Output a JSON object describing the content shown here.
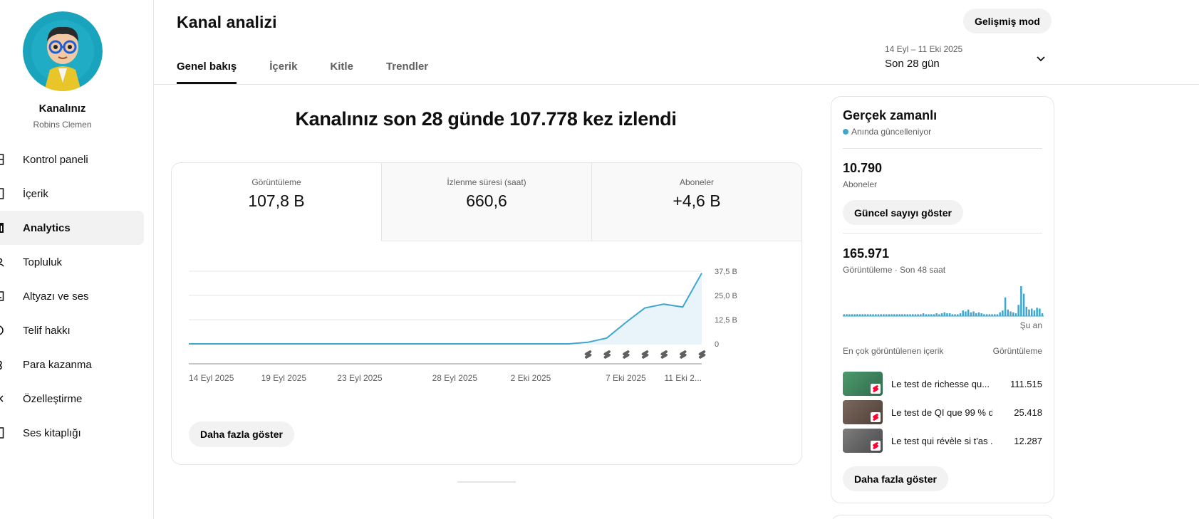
{
  "sidebar": {
    "channel_title": "Kanalınız",
    "channel_handle": "Robins Clemen",
    "items": [
      {
        "label": "Kontrol paneli",
        "icon": "dashboard-icon"
      },
      {
        "label": "İçerik",
        "icon": "content-icon"
      },
      {
        "label": "Analytics",
        "icon": "analytics-icon"
      },
      {
        "label": "Topluluk",
        "icon": "community-icon"
      },
      {
        "label": "Altyazı ve ses",
        "icon": "subtitles-icon"
      },
      {
        "label": "Telif hakkı",
        "icon": "copyright-icon"
      },
      {
        "label": "Para kazanma",
        "icon": "monetization-icon"
      },
      {
        "label": "Özelleştirme",
        "icon": "customization-icon"
      },
      {
        "label": "Ses kitaplığı",
        "icon": "audio-library-icon"
      }
    ]
  },
  "header": {
    "title": "Kanal analizi",
    "advanced_mode": "Gelişmiş mod",
    "tabs": [
      "Genel bakış",
      "İçerik",
      "Kitle",
      "Trendler"
    ],
    "date_range": "14 Eyl – 11 Eki 2025",
    "period": "Son 28 gün"
  },
  "main": {
    "headline": "Kanalınız son 28 günde 107.778 kez izlendi",
    "metrics": [
      {
        "label": "Görüntüleme",
        "value": "107,8 B"
      },
      {
        "label": "İzlenme süresi (saat)",
        "value": "660,6"
      },
      {
        "label": "Aboneler",
        "value": "+4,6 B"
      }
    ],
    "more_button": "Daha fazla göster"
  },
  "chart_data": {
    "type": "line",
    "x": [
      "14 Eyl",
      "15 Eyl",
      "16 Eyl",
      "17 Eyl",
      "18 Eyl",
      "19 Eyl",
      "20 Eyl",
      "21 Eyl",
      "22 Eyl",
      "23 Eyl",
      "24 Eyl",
      "25 Eyl",
      "26 Eyl",
      "27 Eyl",
      "28 Eyl",
      "29 Eyl",
      "30 Eyl",
      "1 Eki",
      "2 Eki",
      "3 Eki",
      "4 Eki",
      "5 Eki",
      "6 Eki",
      "7 Eki",
      "8 Eki",
      "9 Eki",
      "10 Eki",
      "11 Eki"
    ],
    "series": [
      {
        "values": [
          0,
          0,
          0,
          0,
          0,
          0,
          0,
          0,
          0,
          0,
          0,
          0,
          0,
          0,
          0,
          0,
          0,
          0,
          0,
          0,
          0,
          0.8,
          3,
          11,
          18.5,
          20.5,
          19,
          36.5
        ]
      }
    ],
    "xtick_labels": [
      "14 Eyl 2025",
      "19 Eyl 2025",
      "23 Eyl 2025",
      "28 Eyl 2025",
      "2 Eki 2025",
      "7 Eki 2025",
      "11 Eki 2..."
    ],
    "ytick_labels": [
      "0",
      "12,5 B",
      "25,0 B",
      "37,5 B"
    ],
    "ylim": [
      0,
      37.5
    ],
    "grid": true,
    "short_markers": 7,
    "colors": {
      "line": "#3ea6cf",
      "fill": "#e8f4fa"
    }
  },
  "realtime": {
    "title": "Gerçek zamanlı",
    "subtitle": "Anında güncelleniyor",
    "subscribers_value": "10.790",
    "subscribers_label": "Aboneler",
    "show_count_button": "Güncel sayıyı göster",
    "views_value": "165.971",
    "views_label": "Görüntüleme · Son 48 saat",
    "now_label": "Şu an",
    "top_content_header": "En çok görüntülenen içerik",
    "top_views_header": "Görüntüleme",
    "bars": [
      2,
      2,
      2,
      2,
      2,
      2,
      2,
      2,
      2,
      2,
      2,
      2,
      2,
      2,
      2,
      2,
      2,
      2,
      2,
      2,
      2,
      2,
      2,
      2,
      2,
      2,
      2,
      2,
      2,
      2,
      3,
      2,
      2,
      2,
      2,
      3,
      2,
      3,
      4,
      3,
      3,
      2,
      2,
      2,
      3,
      6,
      5,
      7,
      4,
      5,
      3,
      4,
      3,
      2,
      2,
      2,
      2,
      2,
      2,
      4,
      6,
      20,
      7,
      5,
      4,
      3,
      12,
      32,
      24,
      10,
      7,
      8,
      6,
      9,
      8,
      3
    ],
    "top_items": [
      {
        "title": "Le test de richesse qu...",
        "views": "111.515",
        "color": "#3f7f5f"
      },
      {
        "title": "Le test de QI que 99 % d...",
        "views": "25.418",
        "color": "#6b5a50"
      },
      {
        "title": "Le test qui révèle si t'as ...",
        "views": "12.287",
        "color": "#6a6a6a"
      }
    ],
    "more_button": "Daha fazla göster"
  }
}
